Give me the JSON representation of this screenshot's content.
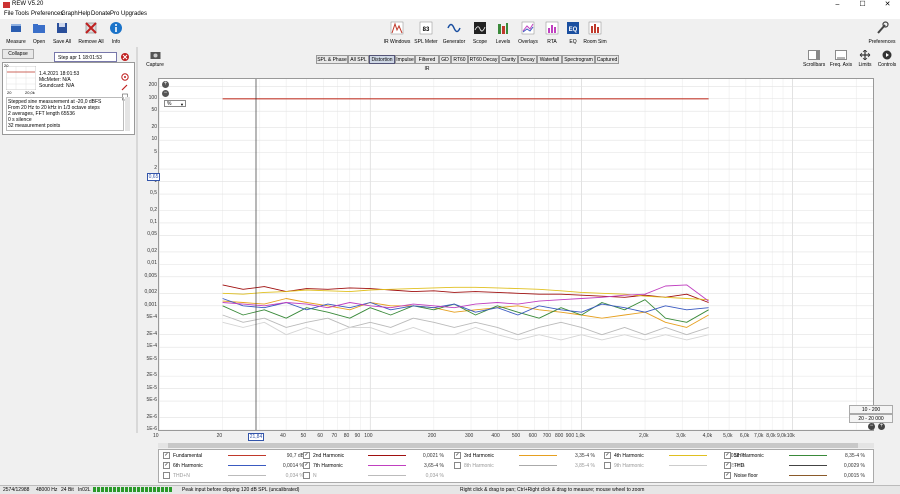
{
  "window": {
    "title": "REW V5.20",
    "minimize": "–",
    "maximize": "☐",
    "close": "✕"
  },
  "menu": [
    "File",
    "Tools",
    "Preferences",
    "Graph",
    "Help",
    "Donate",
    "Pro Upgrades"
  ],
  "toolbar": {
    "left": [
      {
        "label": "Measure",
        "icon": "microphone-icon",
        "color": "#2a5db0"
      },
      {
        "label": "Open",
        "icon": "folder-icon",
        "color": "#3a6fc9"
      },
      {
        "label": "Save All",
        "icon": "disk-icon",
        "color": "#2a4f9a"
      },
      {
        "label": "Remove All",
        "icon": "remove-icon",
        "color": "#c02020"
      },
      {
        "label": "Info",
        "icon": "info-icon",
        "color": "#1a73c9"
      }
    ],
    "center": [
      {
        "label": "IR Windows",
        "icon": "ir-window-icon"
      },
      {
        "label": "SPL Meter",
        "icon": "spl-meter-icon",
        "badge": "83"
      },
      {
        "label": "Generator",
        "icon": "generator-icon"
      },
      {
        "label": "Scope",
        "icon": "scope-icon"
      },
      {
        "label": "Levels",
        "icon": "levels-icon"
      },
      {
        "label": "Overlays",
        "icon": "overlays-icon"
      },
      {
        "label": "RTA",
        "icon": "rta-icon"
      },
      {
        "label": "EQ",
        "icon": "eq-icon"
      },
      {
        "label": "Room Sim",
        "icon": "room-sim-icon"
      }
    ],
    "preferences": "Preferences"
  },
  "left_panel": {
    "collapse": "Collapse",
    "measurement_name": "Step apr 1 18:01:53",
    "mini_chart": {
      "y_top": "20",
      "x_left": "20",
      "x_right": "20,0k"
    },
    "details": [
      "1.4.2021 18:01:53",
      "MicMeter: N/A",
      "Soundcard: N/A"
    ],
    "notes": [
      "Stepped sine measurement at -20,0 dBFS",
      "From 20 Hz to 20 kHz in 1/3 octave steps",
      "2 averages, FFT length 65536",
      "0 s silence",
      "32 measurement points"
    ]
  },
  "capture": "Capture",
  "tabs": [
    "SPL & Phase",
    "All SPL",
    "Distortion",
    "Impulse",
    "Filtered IR",
    "GD",
    "RT60",
    "RT60 Decay",
    "Clarity",
    "Decay",
    "Waterfall",
    "Spectrogram",
    "Captured"
  ],
  "active_tab": "Distortion",
  "right_tools": [
    "Scrollbars",
    "Freq. Axis",
    "Limits",
    "Controls"
  ],
  "unit_select": "%",
  "y_axis_labels": [
    "200",
    "100",
    "50",
    "20",
    "10",
    "5",
    "2",
    "1",
    "0,5",
    "0,2",
    "0,1",
    "0,05",
    "0,02",
    "0,01",
    "0,005",
    "0,002",
    "0,001",
    "5E-4",
    "2E-4",
    "1E-4",
    "5E-5",
    "2E-5",
    "1E-5",
    "5E-6",
    "2E-6",
    "1E-6"
  ],
  "y_highlight": "0,65",
  "x_axis_labels": [
    "10",
    "20",
    "30",
    "40",
    "50",
    "60",
    "70",
    "80",
    "90",
    "100",
    "200",
    "300",
    "400",
    "500",
    "600",
    "700",
    "800",
    "900",
    "1,0k",
    "2,0k",
    "3,0k",
    "4,0k",
    "5,0k",
    "6,0k",
    "7,0k",
    "8,0k",
    "9,0k",
    "10k",
    "4,8kHz"
  ],
  "x_highlight": "21,84",
  "range_buttons": [
    "10 - 200",
    "20 - 20 000"
  ],
  "zoom": {
    "out": "−",
    "in": "+"
  },
  "legend": [
    {
      "name": "Fundamental",
      "value": "90,7 dB",
      "color": "#c0392b",
      "checked": true
    },
    {
      "name": "2nd Harmonic",
      "value": "0,0021 %",
      "color": "#a01010",
      "checked": true
    },
    {
      "name": "3rd Harmonic",
      "value": "3,35-4 %",
      "color": "#e6a020",
      "checked": true
    },
    {
      "name": "4th Harmonic",
      "value": "0,0012 %",
      "color": "#e0c020",
      "checked": true
    },
    {
      "name": "5th Harmonic",
      "value": "8,35-4 %",
      "color": "#3a8a3a",
      "checked": true
    },
    {
      "name": "6th Harmonic",
      "value": "0,0014 %",
      "color": "#3a5ac0",
      "checked": true
    },
    {
      "name": "7th Harmonic",
      "value": "3,65-4 %",
      "color": "#c040c0",
      "checked": true
    },
    {
      "name": "8th Harmonic",
      "value": "3,85-4 %",
      "color": "#aaaaaa",
      "checked": false
    },
    {
      "name": "9th Harmonic",
      "value": "3,85-4 %",
      "color": "#cccccc",
      "checked": false
    },
    {
      "name": "THD",
      "value": "0,0029 %",
      "color": "#444444",
      "checked": true
    },
    {
      "name": "Noise floor",
      "value": "0,0015 %",
      "color": "#8a5a2a",
      "checked": true
    },
    {
      "name": "THD+N",
      "value": "0,034 %",
      "color": "#bbbbbb",
      "checked": false
    },
    {
      "name": "N",
      "value": "0,034 %",
      "color": "#bbbbbb",
      "checked": false
    }
  ],
  "status": {
    "left": "2574/12988",
    "rate": "48000 Hz",
    "bits": "24 Bit",
    "device": "In02L",
    "message": "Peak input before clipping 120 dB SPL (uncalibrated)",
    "hint": "Right click & drag to pan; Ctrl+Right click & drag to measure; mouse wheel to zoom"
  },
  "chart_data": {
    "type": "line",
    "xlabel": "",
    "ylabel": "",
    "x_scale": "log",
    "y_scale": "log",
    "xlim": [
      10,
      24000
    ],
    "ylim": [
      1e-06,
      300
    ],
    "x": [
      20,
      25,
      31.5,
      40,
      50,
      63,
      80,
      100,
      125,
      160,
      200,
      250,
      315,
      400,
      500,
      630,
      800,
      1000,
      1250,
      1600,
      2000,
      2500,
      3150,
      4000
    ],
    "series": [
      {
        "name": "Fundamental",
        "color": "#c0392b",
        "values": [
          100,
          100,
          100,
          100,
          100,
          100,
          100,
          100,
          100,
          100,
          100,
          100,
          100,
          100,
          100,
          100,
          100,
          100,
          100,
          100,
          100,
          100,
          100,
          100
        ]
      },
      {
        "name": "2nd Harmonic",
        "color": "#a01010",
        "values": [
          0.0032,
          0.0025,
          0.0029,
          0.0022,
          0.0026,
          0.0025,
          0.0027,
          0.0026,
          0.0024,
          0.0022,
          0.0023,
          0.0021,
          0.0022,
          0.0021,
          0.002,
          0.0019,
          0.0019,
          0.0018,
          0.0017,
          0.0016,
          0.0018,
          0.0016,
          0.0019,
          0.0012
        ]
      },
      {
        "name": "3rd Harmonic",
        "color": "#e6a020",
        "values": [
          0.0013,
          0.0012,
          0.0011,
          0.0015,
          0.0012,
          0.001,
          0.0008,
          0.0012,
          0.001,
          0.001,
          0.0009,
          0.0007,
          0.0008,
          0.0009,
          0.001,
          0.0008,
          0.0007,
          0.0006,
          0.0005,
          0.0006,
          0.0007,
          0.0004,
          0.0003,
          0.0006
        ]
      },
      {
        "name": "4th Harmonic",
        "color": "#e0c020",
        "values": [
          0.002,
          0.0019,
          0.0021,
          0.0022,
          0.0024,
          0.0023,
          0.0022,
          0.0024,
          0.0025,
          0.0026,
          0.0027,
          0.0028,
          0.0028,
          0.0027,
          0.0026,
          0.0025,
          0.0023,
          0.0021,
          0.002,
          0.0019,
          0.0017,
          0.0016,
          0.0015,
          0.0014
        ]
      },
      {
        "name": "5th Harmonic",
        "color": "#3a8a3a",
        "values": [
          0.001,
          0.0006,
          0.0008,
          0.0005,
          0.0009,
          0.0007,
          0.0005,
          0.0009,
          0.0006,
          0.001,
          0.0008,
          0.0011,
          0.0006,
          0.001,
          0.0007,
          0.0005,
          0.0009,
          0.0006,
          0.0012,
          0.0008,
          0.0014,
          0.0005,
          0.0004,
          0.0008
        ]
      },
      {
        "name": "6th Harmonic",
        "color": "#3a5ac0",
        "values": [
          0.0015,
          0.001,
          0.0009,
          0.0012,
          0.0008,
          0.0011,
          0.0009,
          0.0012,
          0.0008,
          0.001,
          0.0009,
          0.0011,
          0.0007,
          0.0009,
          0.0006,
          0.001,
          0.0008,
          0.0007,
          0.0011,
          0.0009,
          0.0007,
          0.001,
          0.0008,
          0.0009
        ]
      },
      {
        "name": "7th Harmonic",
        "color": "#c040c0",
        "values": [
          0.0012,
          0.0011,
          0.001,
          0.0012,
          0.0011,
          0.0009,
          0.0012,
          0.001,
          0.0009,
          0.0011,
          0.001,
          0.0009,
          0.0011,
          0.0012,
          0.0011,
          0.0013,
          0.0014,
          0.0015,
          0.0016,
          0.0018,
          0.0019,
          0.003,
          0.0032,
          0.0013
        ]
      },
      {
        "name": "8th Harmonic",
        "color": "#bbbbbb",
        "values": [
          0.0006,
          0.0004,
          0.0005,
          0.0003,
          0.0004,
          0.0005,
          0.0003,
          0.0004,
          0.0003,
          0.0005,
          0.0004,
          0.0003,
          0.0004,
          0.0003,
          0.0002,
          0.0003,
          0.0004,
          0.0003,
          0.0002,
          0.0003,
          0.0002,
          0.0003,
          0.0002,
          0.0003
        ]
      },
      {
        "name": "9th Harmonic",
        "color": "#d5d5d5",
        "values": [
          0.0004,
          0.0003,
          0.0004,
          0.0002,
          0.0003,
          0.0002,
          0.0003,
          0.0003,
          0.0002,
          0.0003,
          0.0002,
          0.0002,
          0.0003,
          0.0002,
          0.00015,
          0.0002,
          0.00015,
          0.0002,
          0.00015,
          0.0002,
          0.00015,
          0.0002,
          0.00015,
          0.0002
        ]
      }
    ]
  }
}
